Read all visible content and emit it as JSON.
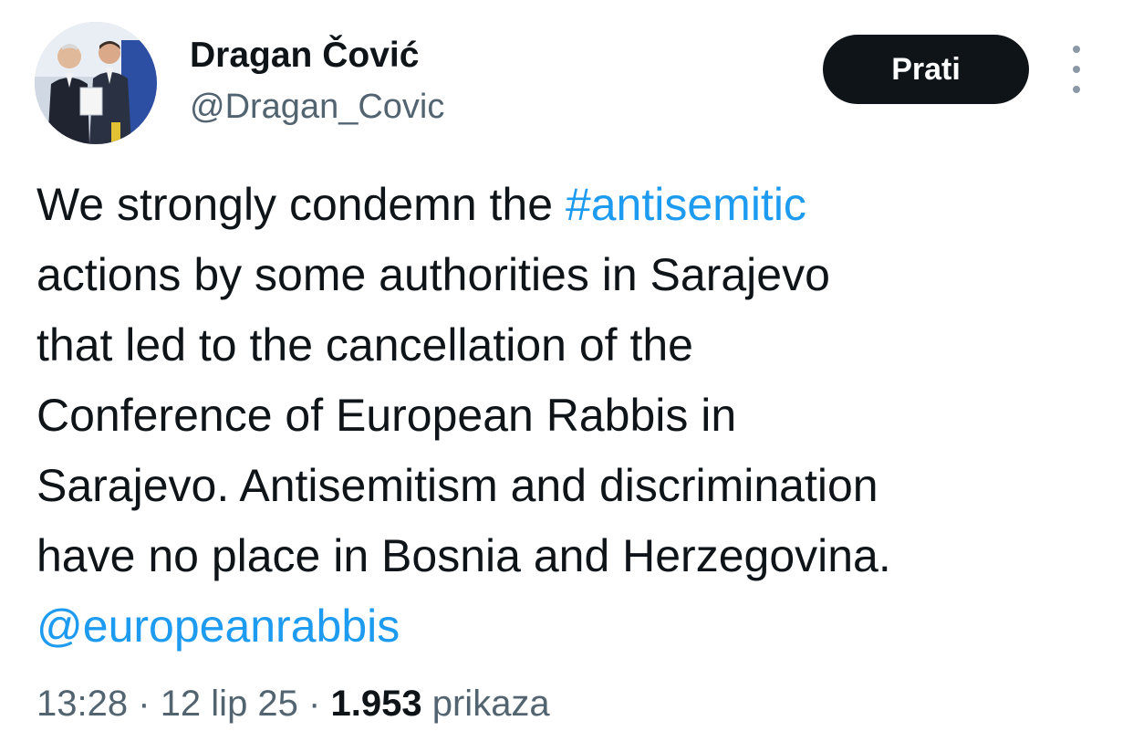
{
  "author": {
    "display_name": "Dragan Čović",
    "handle": "@Dragan_Covic",
    "avatar_icon": "profile-photo"
  },
  "actions": {
    "follow_label": "Prati",
    "more_icon": "vertical-ellipsis-icon"
  },
  "tweet": {
    "lines": [
      {
        "text": "We strongly condemn the ",
        "hashtag": "#antisemitic"
      },
      {
        "text": "actions by some authorities in Sarajevo"
      },
      {
        "text": "that led to the cancellation of the"
      },
      {
        "text": "Conference of European Rabbis in"
      },
      {
        "text": "Sarajevo. Antisemitism and discrimination"
      },
      {
        "text": "have no place in Bosnia and Herzegovina."
      }
    ],
    "mention": "@europeanrabbis"
  },
  "meta": {
    "time": "13:28",
    "separator": "·",
    "date": "12 lip 25",
    "views_count": "1.953",
    "views_label": "prikaza"
  },
  "colors": {
    "link": "#1d9bf0",
    "text": "#0f1419",
    "secondary": "#536471",
    "button_bg": "#0f1419"
  }
}
